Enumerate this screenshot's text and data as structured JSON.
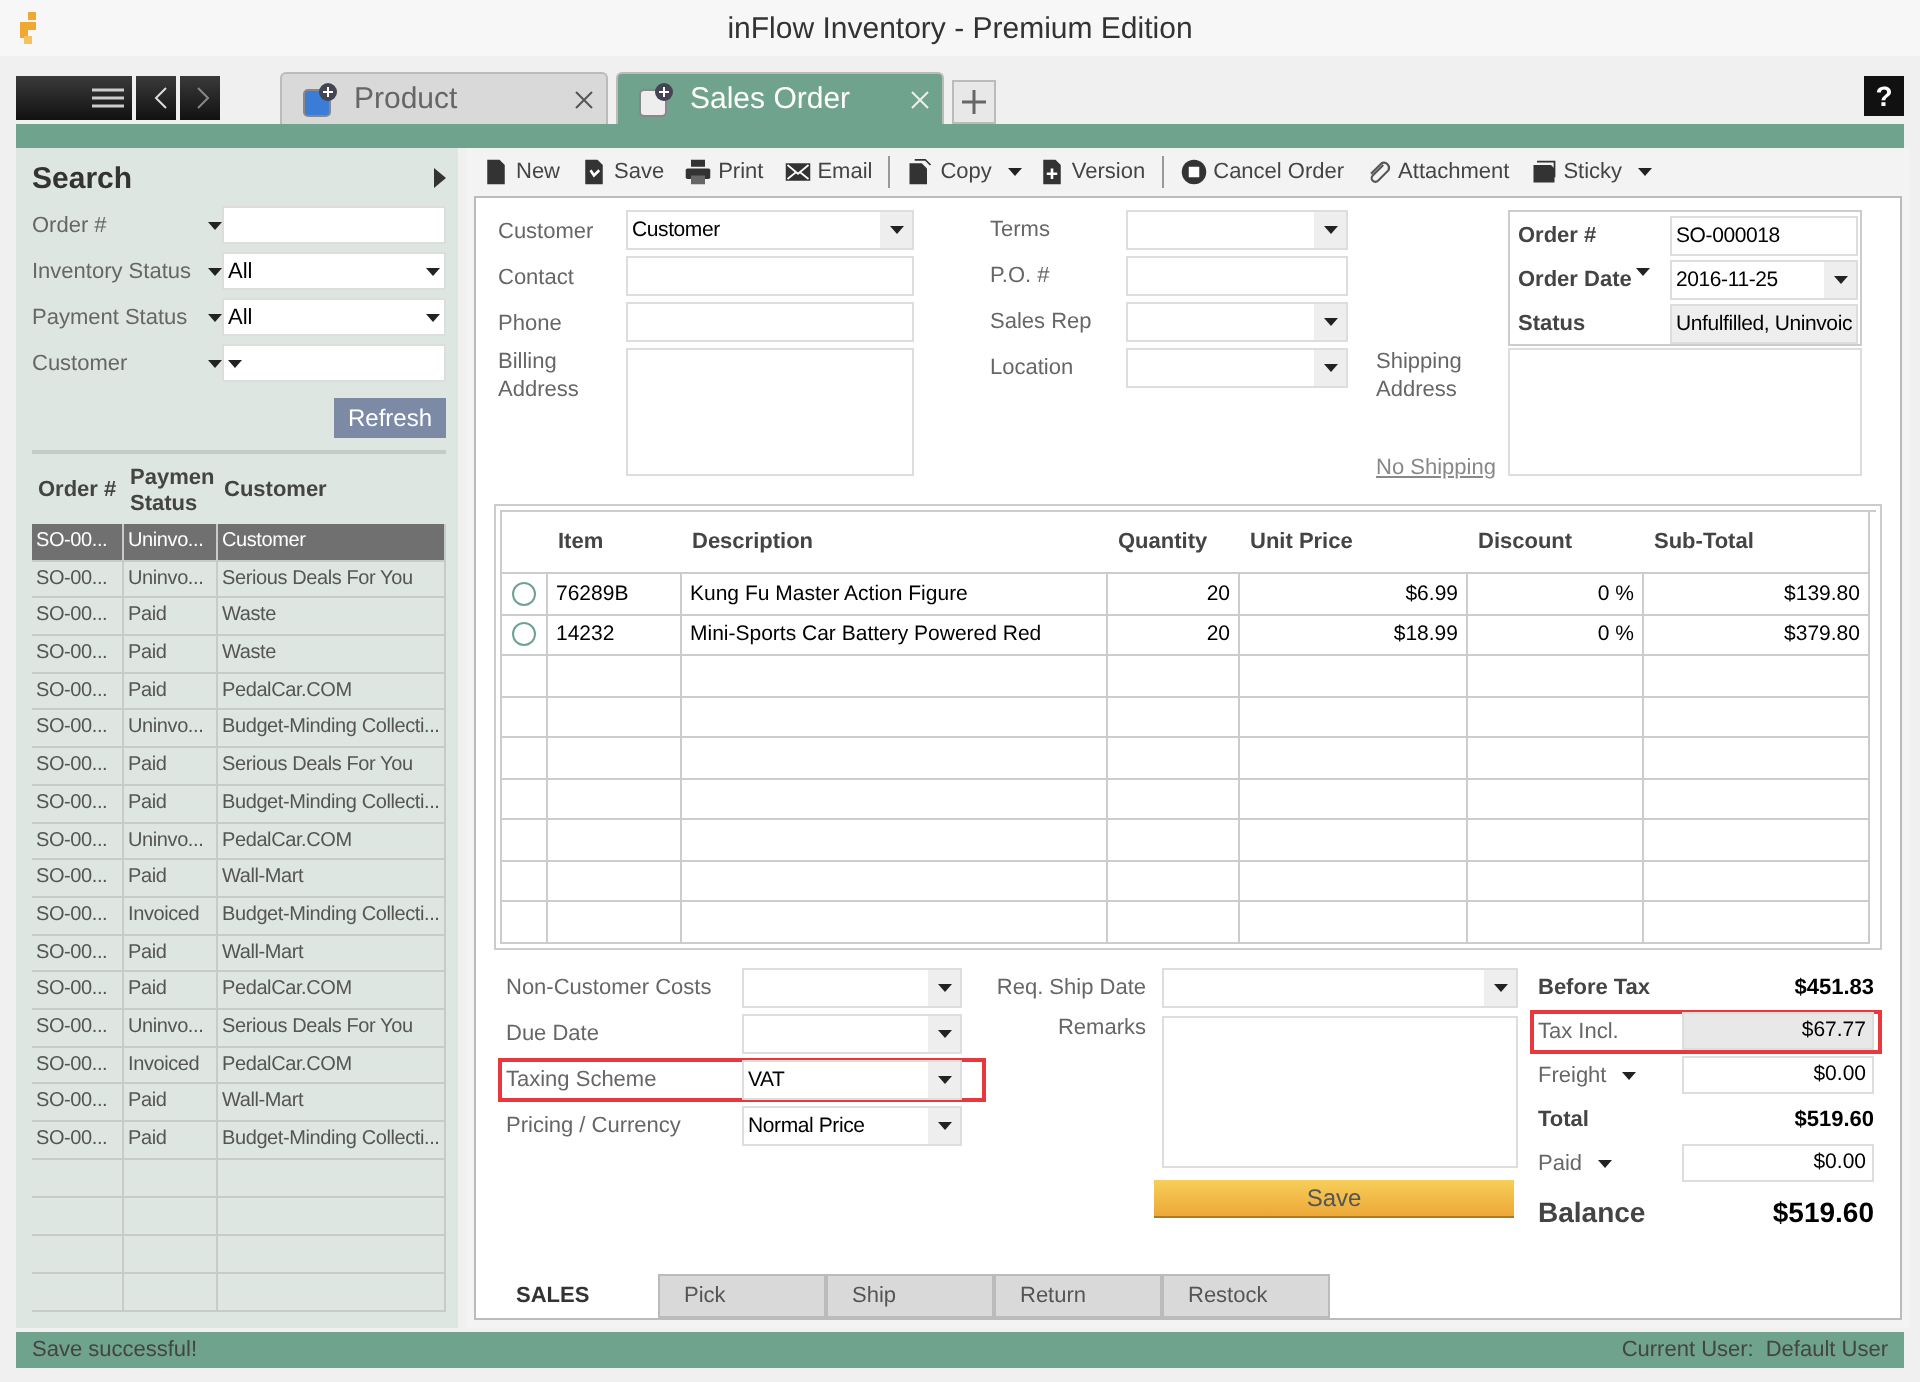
{
  "window": {
    "title": "inFlow Inventory - Premium Edition"
  },
  "tabs": [
    {
      "label": "Product",
      "selected": false
    },
    {
      "label": "Sales Order",
      "selected": true
    }
  ],
  "help": "?",
  "search": {
    "title": "Search",
    "filters": [
      {
        "label": "Order #",
        "kind": "text"
      },
      {
        "label": "Inventory Status",
        "kind": "dropdown",
        "value": "All"
      },
      {
        "label": "Payment Status",
        "kind": "dropdown",
        "value": "All"
      },
      {
        "label": "Customer",
        "kind": "dropdown"
      }
    ],
    "refresh": "Refresh"
  },
  "orders": {
    "columns": [
      "Order #",
      "Paymen Status",
      "Customer"
    ],
    "rows": [
      {
        "order": "SO-00...",
        "payment": "Uninvo...",
        "customer": "Customer",
        "selected": true
      },
      {
        "order": "SO-00...",
        "payment": "Uninvo...",
        "customer": "Serious Deals For You",
        "selected": false
      },
      {
        "order": "SO-00...",
        "payment": "Paid",
        "customer": "Waste",
        "selected": false
      },
      {
        "order": "SO-00...",
        "payment": "Paid",
        "customer": "Waste",
        "selected": false
      },
      {
        "order": "SO-00...",
        "payment": "Paid",
        "customer": "PedalCar.COM",
        "selected": false
      },
      {
        "order": "SO-00...",
        "payment": "Uninvo...",
        "customer": "Budget-Minding Collecti...",
        "selected": false
      },
      {
        "order": "SO-00...",
        "payment": "Paid",
        "customer": "Serious Deals For You",
        "selected": false
      },
      {
        "order": "SO-00...",
        "payment": "Paid",
        "customer": "Budget-Minding Collecti...",
        "selected": false
      },
      {
        "order": "SO-00...",
        "payment": "Uninvo...",
        "customer": "PedalCar.COM",
        "selected": false
      },
      {
        "order": "SO-00...",
        "payment": "Paid",
        "customer": "Wall-Mart",
        "selected": false
      },
      {
        "order": "SO-00...",
        "payment": "Invoiced",
        "customer": "Budget-Minding Collecti...",
        "selected": false
      },
      {
        "order": "SO-00...",
        "payment": "Paid",
        "customer": "Wall-Mart",
        "selected": false
      },
      {
        "order": "SO-00...",
        "payment": "Paid",
        "customer": "PedalCar.COM",
        "selected": false
      },
      {
        "order": "SO-00...",
        "payment": "Uninvo...",
        "customer": "Serious Deals For You",
        "selected": false
      },
      {
        "order": "SO-00...",
        "payment": "Invoiced",
        "customer": "PedalCar.COM",
        "selected": false
      },
      {
        "order": "SO-00...",
        "payment": "Paid",
        "customer": "Wall-Mart",
        "selected": false
      },
      {
        "order": "SO-00...",
        "payment": "Paid",
        "customer": "Budget-Minding Collecti...",
        "selected": false
      }
    ]
  },
  "toolbar": {
    "groups": [
      [
        {
          "label": "New",
          "kind": "button"
        },
        {
          "label": "Save",
          "kind": "button"
        },
        {
          "label": "Print",
          "kind": "button"
        },
        {
          "label": "Email",
          "kind": "button"
        }
      ],
      [
        {
          "label": "Copy",
          "kind": "menu"
        },
        {
          "label": "Version",
          "kind": "button"
        }
      ],
      [
        {
          "label": "Cancel Order",
          "kind": "button"
        },
        {
          "label": "Attachment",
          "kind": "button"
        },
        {
          "label": "Sticky",
          "kind": "menu"
        }
      ]
    ]
  },
  "form": {
    "customer_fields": [
      {
        "label": "Customer",
        "kind": "dropdown",
        "value": "Customer"
      },
      {
        "label": "Contact",
        "kind": "text"
      },
      {
        "label": "Phone",
        "kind": "text"
      },
      {
        "label": "Billing Address",
        "kind": "area"
      }
    ],
    "order_fields": [
      {
        "label": "Terms",
        "kind": "dropdown"
      },
      {
        "label": "P.O. #",
        "kind": "text"
      },
      {
        "label": "Sales Rep",
        "kind": "dropdown"
      },
      {
        "label": "Location",
        "kind": "dropdown"
      }
    ],
    "order_info": [
      {
        "label": "Order #",
        "kind": "text",
        "value": "SO-000018"
      },
      {
        "label": "Order Date",
        "kind": "date",
        "value": "2016-11-25"
      },
      {
        "label": "Status",
        "kind": "readonly",
        "value": "Unfulfilled, Uninvoic"
      }
    ],
    "shipping": {
      "label": "Shipping Address",
      "link": "No Shipping"
    }
  },
  "items": {
    "columns": [
      "Item",
      "Description",
      "Quantity",
      "Unit Price",
      "Discount",
      "Sub-Total"
    ],
    "rows": [
      {
        "item": "76289B",
        "description": "Kung Fu Master Action Figure",
        "quantity": "20",
        "unit_price": "$6.99",
        "discount": "0 %",
        "subtotal": "$139.80",
        "selected": false
      },
      {
        "item": "14232",
        "description": "Mini-Sports Car Battery Powered Red",
        "quantity": "20",
        "unit_price": "$18.99",
        "discount": "0 %",
        "subtotal": "$379.80",
        "selected": false
      }
    ]
  },
  "extra_fields": [
    {
      "label": "Non-Customer Costs",
      "highlighted": false
    },
    {
      "label": "Due Date",
      "highlighted": false
    },
    {
      "label": "Taxing Scheme",
      "value": "VAT",
      "highlighted": true
    },
    {
      "label": "Pricing / Currency",
      "value": "Normal Price",
      "highlighted": false
    }
  ],
  "ship_date": {
    "label": "Req. Ship Date"
  },
  "remarks": {
    "label": "Remarks"
  },
  "save_button": "Save",
  "totals": [
    {
      "label": "Before Tax",
      "value": "$451.83",
      "kind": "bold",
      "highlighted": false
    },
    {
      "label": "Tax Incl.",
      "value": "$67.77",
      "kind": "readonly",
      "highlighted": true
    },
    {
      "label": "Freight",
      "value": "$0.00",
      "kind": "input",
      "highlighted": false
    },
    {
      "label": "Total",
      "value": "$519.60",
      "kind": "bold",
      "highlighted": false
    },
    {
      "label": "Paid",
      "value": "$0.00",
      "kind": "input",
      "highlighted": false
    },
    {
      "label": "Balance",
      "value": "$519.60",
      "kind": "big",
      "highlighted": false
    }
  ],
  "bottom_tabs": [
    {
      "label": "SALES",
      "selected": true
    },
    {
      "label": "Pick",
      "selected": false
    },
    {
      "label": "Ship",
      "selected": false
    },
    {
      "label": "Return",
      "selected": false
    },
    {
      "label": "Restock",
      "selected": false
    }
  ],
  "status_bar": {
    "message": "Save successful!",
    "user_label": "Current User:",
    "user": "Default User"
  }
}
